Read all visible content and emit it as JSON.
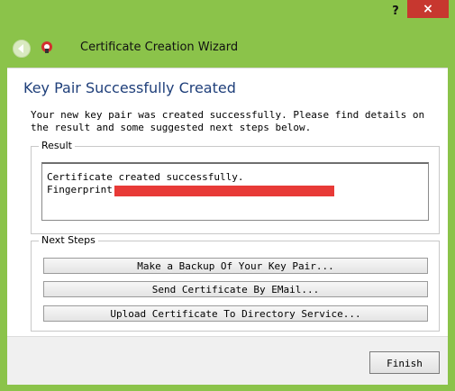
{
  "window": {
    "title": "Certificate Creation Wizard",
    "help_label": "?",
    "close_label": "×"
  },
  "page": {
    "heading": "Key Pair Successfully Created",
    "description": "Your new key pair was created successfully. Please find details on the result and some suggested next steps below."
  },
  "result": {
    "legend": "Result",
    "lines": [
      "Certificate created successfully.",
      "Fingerprint:"
    ],
    "redaction_color": "#e83a37"
  },
  "next_steps": {
    "legend": "Next Steps",
    "buttons": [
      "Make a Backup Of Your Key Pair...",
      "Send Certificate By EMail...",
      "Upload Certificate To Directory Service..."
    ]
  },
  "footer": {
    "finish_label": "Finish"
  },
  "colors": {
    "frame": "#8bc34a",
    "accent_heading": "#1f3f7a",
    "close": "#c7372f"
  },
  "icons": {
    "back": "back-arrow-icon",
    "app": "certificate-app-icon"
  }
}
